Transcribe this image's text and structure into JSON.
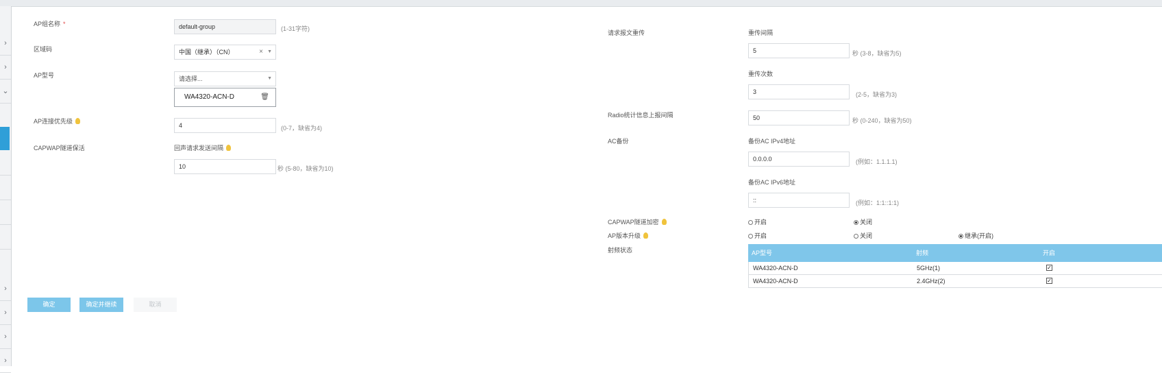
{
  "left": {
    "group_name_label": "AP组名称",
    "group_name_required": "*",
    "group_name_value": "default-group",
    "group_name_hint": "(1-31字符)",
    "region_label": "区域码",
    "region_value": "中国（继承）（CN）",
    "model_label": "AP型号",
    "model_placeholder": "请选择...",
    "model_selected": "WA4320-ACN-D",
    "priority_label": "AP连接优先级",
    "priority_value": "4",
    "priority_hint": "(0-7，缺省为4)",
    "keepalive_label": "CAPWAP隧道保活",
    "echo_label": "回声请求发送间隔",
    "echo_value": "10",
    "echo_hint": "秒 (5-80，缺省为10)"
  },
  "right": {
    "retransmit_label": "请求报文重传",
    "retrans_interval_label": "重传间隔",
    "retrans_interval_value": "5",
    "retrans_interval_hint": "秒 (3-8，缺省为5)",
    "retrans_count_label": "重传次数",
    "retrans_count_value": "3",
    "retrans_count_hint": "(2-5，缺省为3)",
    "radio_stats_label": "Radio统计信息上报间隔",
    "radio_stats_value": "50",
    "radio_stats_hint": "秒 (0-240，缺省为50)",
    "ac_backup_label": "AC备份",
    "ipv4_label": "备份AC IPv4地址",
    "ipv4_value": "0.0.0.0",
    "ipv4_hint": "(例如：1.1.1.1)",
    "ipv6_label": "备份AC IPv6地址",
    "ipv6_value": "::",
    "ipv6_hint": "(例如：1:1::1:1)",
    "encrypt_label": "CAPWAP隧道加密",
    "encrypt_on": "开启",
    "encrypt_off": "关闭",
    "encrypt_selected": "off",
    "upgrade_label": "AP版本升级",
    "upgrade_on": "开启",
    "upgrade_off": "关闭",
    "upgrade_inherit": "继承(开启)",
    "upgrade_selected": "inherit",
    "radio_state_label": "射频状态"
  },
  "table": {
    "headers": [
      "AP型号",
      "射频",
      "开启"
    ],
    "rows": [
      {
        "model": "WA4320-ACN-D",
        "radio": "5GHz(1)",
        "enabled": true
      },
      {
        "model": "WA4320-ACN-D",
        "radio": "2.4GHz(2)",
        "enabled": true
      }
    ]
  },
  "buttons": {
    "ok": "确定",
    "ok_continue": "确定并继续",
    "cancel": "取消"
  },
  "colors": {
    "accent": "#2f9fd8",
    "table_header": "#7fc6ea",
    "button": "#7cc6ea",
    "required": "#e04848",
    "hint_bulb": "#f0c33c"
  },
  "icons": {
    "sidebar": [
      "chevron-right-icon",
      "chevron-right-icon",
      "chevron-down-icon",
      "chevron-right-icon",
      "chevron-right-icon",
      "chevron-right-icon",
      "chevron-right-icon"
    ],
    "clear": "close-icon",
    "dropdown": "caret-down-icon",
    "remove": "trash-icon",
    "hint": "lightbulb-icon"
  }
}
